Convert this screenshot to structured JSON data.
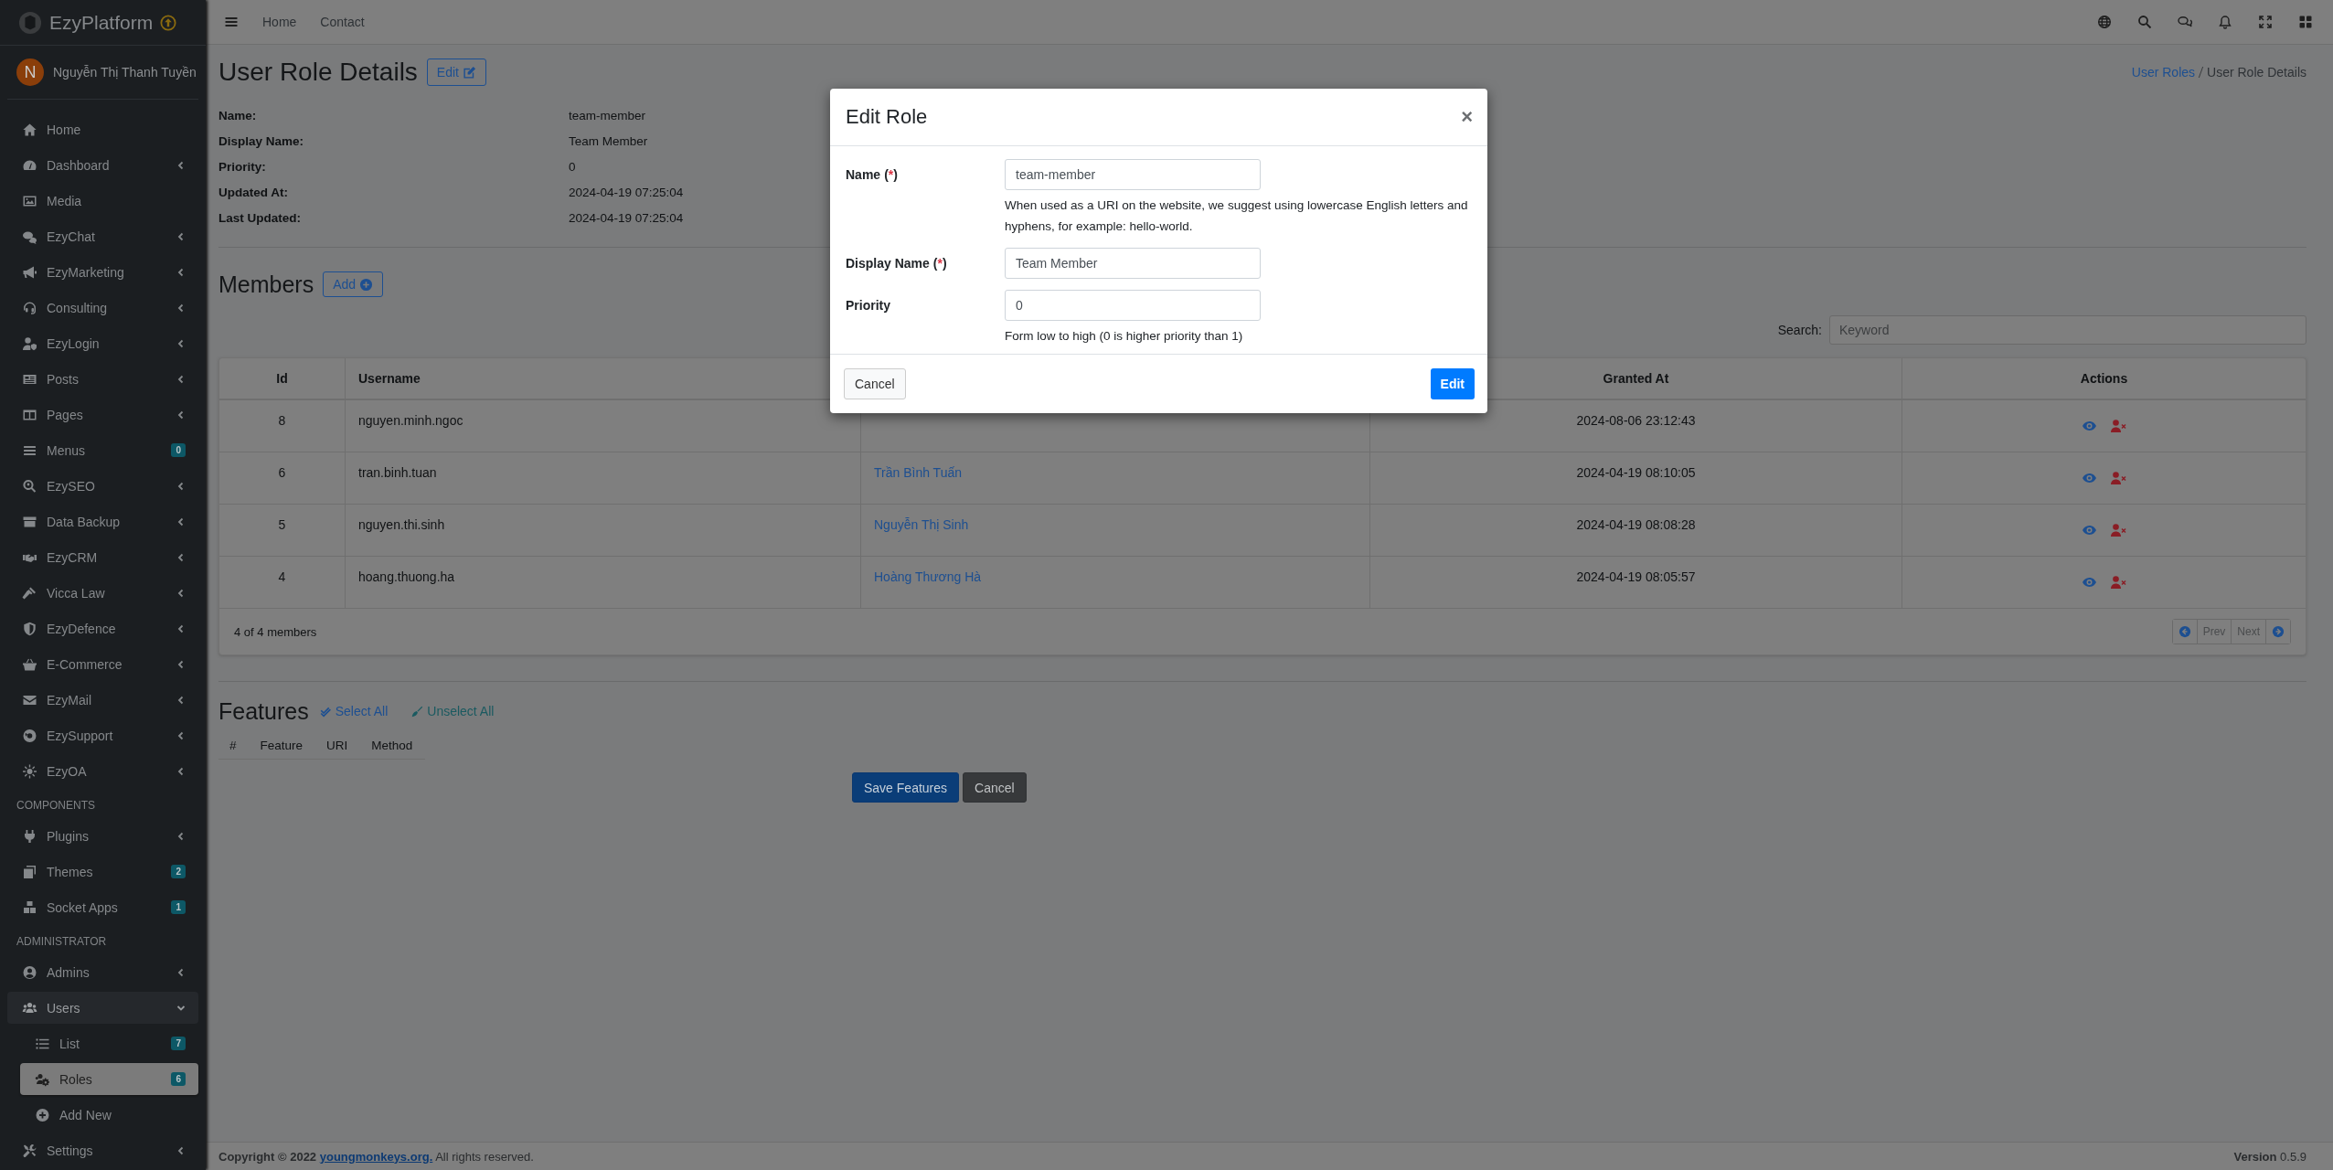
{
  "brand": {
    "name": "EzyPlatform"
  },
  "user": {
    "initial": "N",
    "name": "Nguyễn Thị Thanh Tuyền"
  },
  "sidebar": {
    "items": [
      {
        "kind": "link",
        "label": "Home",
        "selected": false
      },
      {
        "kind": "menu",
        "label": "Dashboard",
        "expanded": false,
        "selected": false
      },
      {
        "kind": "link",
        "label": "Media",
        "selected": false
      },
      {
        "kind": "menu",
        "label": "EzyChat",
        "expanded": false,
        "selected": false
      },
      {
        "kind": "menu",
        "label": "EzyMarketing",
        "expanded": false,
        "selected": false
      },
      {
        "kind": "menu",
        "label": "Consulting",
        "expanded": false,
        "selected": false
      },
      {
        "kind": "menu",
        "label": "EzyLogin",
        "expanded": false,
        "selected": false
      },
      {
        "kind": "menu",
        "label": "Posts",
        "expanded": false,
        "selected": false
      },
      {
        "kind": "menu",
        "label": "Pages",
        "expanded": false,
        "selected": false
      },
      {
        "kind": "link",
        "label": "Menus",
        "badge": "0",
        "selected": false
      },
      {
        "kind": "menu",
        "label": "EzySEO",
        "expanded": false,
        "selected": false
      },
      {
        "kind": "menu",
        "label": "Data Backup",
        "expanded": false,
        "selected": false
      },
      {
        "kind": "menu",
        "label": "EzyCRM",
        "expanded": false,
        "selected": false
      },
      {
        "kind": "menu",
        "label": "Vicca Law",
        "expanded": false,
        "selected": false
      },
      {
        "kind": "menu",
        "label": "EzyDefence",
        "expanded": false,
        "selected": false
      },
      {
        "kind": "menu",
        "label": "E-Commerce",
        "expanded": false,
        "selected": false
      },
      {
        "kind": "menu",
        "label": "EzyMail",
        "expanded": false,
        "selected": false
      },
      {
        "kind": "menu",
        "label": "EzySupport",
        "expanded": false,
        "selected": false
      },
      {
        "kind": "menu",
        "label": "EzyOA",
        "expanded": false,
        "selected": false
      },
      {
        "kind": "header",
        "label": "COMPONENTS"
      },
      {
        "kind": "menu",
        "label": "Plugins",
        "expanded": false,
        "selected": false
      },
      {
        "kind": "link",
        "label": "Themes",
        "badge": "2",
        "selected": false
      },
      {
        "kind": "link",
        "label": "Socket Apps",
        "badge": "1",
        "selected": false
      },
      {
        "kind": "header",
        "label": "ADMINISTRATOR"
      },
      {
        "kind": "menu",
        "label": "Admins",
        "expanded": false,
        "selected": false
      },
      {
        "kind": "menu",
        "label": "Users",
        "expanded": true,
        "selected": false,
        "children": [
          {
            "label": "List",
            "badge": "7",
            "selected": false
          },
          {
            "label": "Roles",
            "badge": "6",
            "selected": true
          },
          {
            "label": "Add New",
            "selected": false
          }
        ]
      },
      {
        "kind": "menu",
        "label": "Settings",
        "expanded": false,
        "selected": false
      }
    ]
  },
  "topbar": {
    "links": [
      "Home",
      "Contact"
    ]
  },
  "page": {
    "title": "User Role Details",
    "edit_button": "Edit",
    "breadcrumb": [
      {
        "label": "User Roles",
        "kind": "link"
      },
      {
        "label": "User Role Details",
        "kind": "current"
      }
    ]
  },
  "details": [
    {
      "label": "Name:",
      "value": "team-member"
    },
    {
      "label": "Display Name:",
      "value": "Team Member"
    },
    {
      "label": "Priority:",
      "value": "0"
    },
    {
      "label": "Updated At:",
      "value": "2024-04-19 07:25:04"
    },
    {
      "label": "Last Updated:",
      "value": "2024-04-19 07:25:04"
    }
  ],
  "members": {
    "title": "Members",
    "add_button": "Add",
    "search_label": "Search:",
    "search": {
      "placeholder": "Keyword"
    },
    "header": {
      "id": "Id",
      "username": "Username",
      "granted_at": "Granted At",
      "actions": "Actions"
    },
    "rows": [
      {
        "id": "8",
        "username": "nguyen.minh.ngoc",
        "granted_at": "2024-08-06 23:12:43"
      },
      {
        "id": "6",
        "username": "tran.binh.tuan",
        "display_name": "Trần Bình Tuấn",
        "granted_at": "2024-04-19 08:10:05"
      },
      {
        "id": "5",
        "username": "nguyen.thi.sinh",
        "display_name": "Nguyễn Thị Sinh",
        "granted_at": "2024-04-19 08:08:28"
      },
      {
        "id": "4",
        "username": "hoang.thuong.ha",
        "display_name": "Hoàng Thương Hà",
        "granted_at": "2024-04-19 08:05:57"
      }
    ],
    "count": "4 of 4 members",
    "pagination": {
      "prev": {
        "label": "Prev",
        "disabled": true
      },
      "next": {
        "label": "Next",
        "disabled": true
      }
    }
  },
  "features": {
    "title": "Features",
    "select_all": "Select All",
    "unselect_all": "Unselect All",
    "columns": [
      "#",
      "Feature",
      "URI",
      "Method"
    ],
    "save_button": "Save Features",
    "cancel_button": "Cancel"
  },
  "footer": {
    "prefix": "Copyright © 2022",
    "link": "youngmonkeys.org.",
    "suffix": "All rights reserved.",
    "version": "**Version** 0.5.9"
  },
  "modal": {
    "title": "Edit Role",
    "close": "×",
    "fields": [
      {
        "label": "Name",
        "required": true,
        "value": "team-member",
        "help": "When used as a URI on the website, we suggest using lowercase English letters and hyphens, for example: hello-world."
      },
      {
        "label": "Display Name",
        "required": true,
        "value": "Team Member"
      },
      {
        "label": "Priority",
        "required": false,
        "value": "0",
        "help": "Form low to high (0 is higher priority than 1)"
      }
    ],
    "required_mark": "(*)",
    "cancel_button": "Cancel",
    "submit_button": "Edit"
  }
}
